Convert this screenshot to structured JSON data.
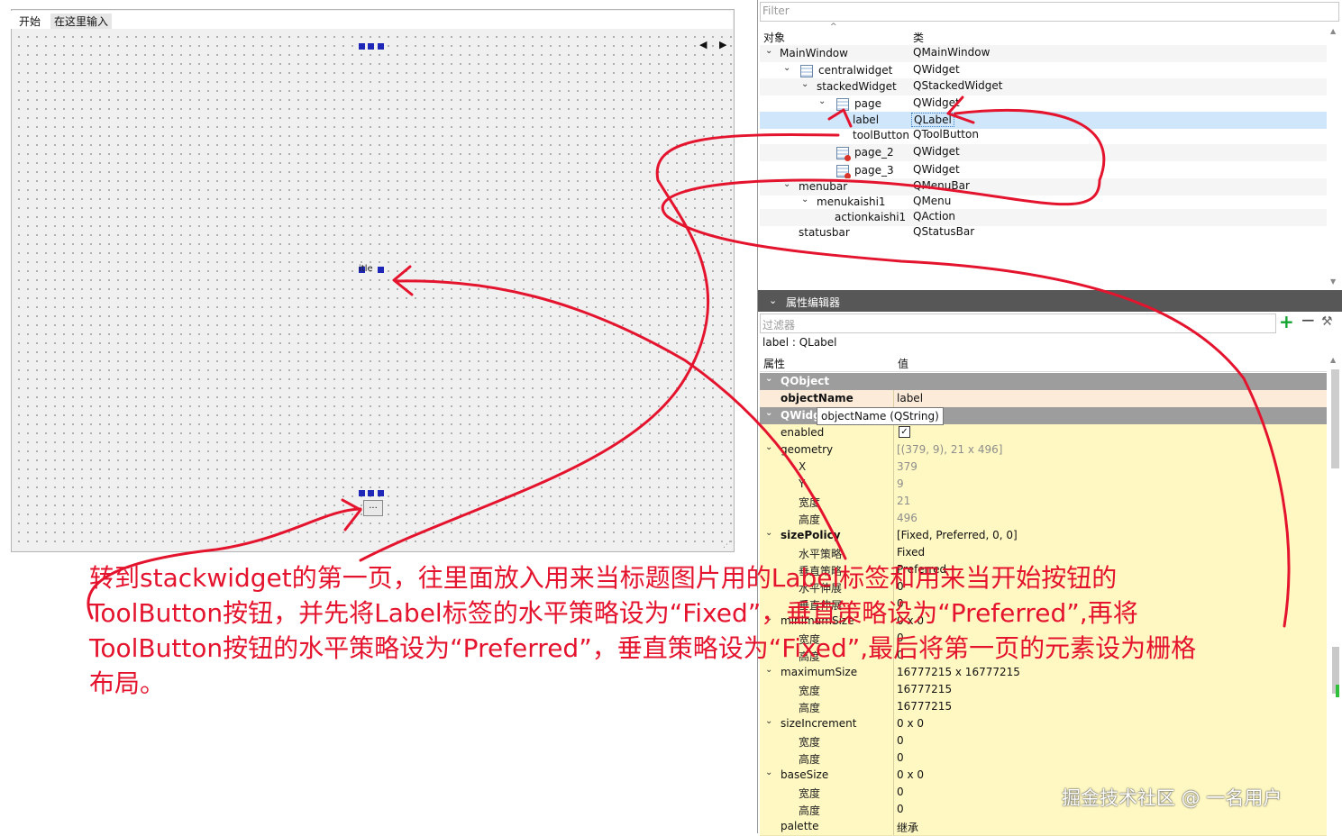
{
  "designer": {
    "menu": {
      "start": "开始",
      "add_placeholder": "在这里输入"
    },
    "label_text": "itle",
    "tool_button_text": "...",
    "nav_arrows": "◀ ▶"
  },
  "object_inspector": {
    "filter_placeholder": "Filter",
    "col_object": "对象",
    "col_class": "类",
    "rows": [
      {
        "name": "MainWindow",
        "class": "QMainWindow"
      },
      {
        "name": "centralwidget",
        "class": "QWidget"
      },
      {
        "name": "stackedWidget",
        "class": "QStackedWidget"
      },
      {
        "name": "page",
        "class": "QWidget"
      },
      {
        "name": "label",
        "class": "QLabel"
      },
      {
        "name": "toolButton",
        "class": "QToolButton"
      },
      {
        "name": "page_2",
        "class": "QWidget"
      },
      {
        "name": "page_3",
        "class": "QWidget"
      },
      {
        "name": "menubar",
        "class": "QMenuBar"
      },
      {
        "name": "menukaishi1",
        "class": "QMenu"
      },
      {
        "name": "actionkaishi1",
        "class": "QAction"
      },
      {
        "name": "statusbar",
        "class": "QStatusBar"
      }
    ]
  },
  "property_editor": {
    "title": "属性编辑器",
    "filter_placeholder": "过滤器",
    "object_info": "label : QLabel",
    "col_property": "属性",
    "col_value": "值",
    "tooltip": "objectName (QString)",
    "rows": [
      {
        "name": "QObject",
        "value": ""
      },
      {
        "name": "objectName",
        "value": "label"
      },
      {
        "name": "QWidget",
        "value": ""
      },
      {
        "name": "enabled",
        "value": "✓"
      },
      {
        "name": "geometry",
        "value": "[(379, 9), 21 x 496]"
      },
      {
        "name": "X",
        "value": "379"
      },
      {
        "name": "Y",
        "value": "9"
      },
      {
        "name": "宽度",
        "value": "21"
      },
      {
        "name": "高度",
        "value": "496"
      },
      {
        "name": "sizePolicy",
        "value": "[Fixed, Preferred, 0, 0]"
      },
      {
        "name": "水平策略",
        "value": "Fixed"
      },
      {
        "name": "垂直策略",
        "value": "Preferred"
      },
      {
        "name": "水平伸展",
        "value": "0"
      },
      {
        "name": "垂直伸展",
        "value": "0"
      },
      {
        "name": "minimumSize",
        "value": "0 x 0"
      },
      {
        "name": "宽度",
        "value": "0"
      },
      {
        "name": "高度",
        "value": "0"
      },
      {
        "name": "maximumSize",
        "value": "16777215 x 16777215"
      },
      {
        "name": "宽度",
        "value": "16777215"
      },
      {
        "name": "高度",
        "value": "16777215"
      },
      {
        "name": "sizeIncrement",
        "value": "0 x 0"
      },
      {
        "name": "宽度",
        "value": "0"
      },
      {
        "name": "高度",
        "value": "0"
      },
      {
        "name": "baseSize",
        "value": "0 x 0"
      },
      {
        "name": "宽度",
        "value": "0"
      },
      {
        "name": "高度",
        "value": "0"
      },
      {
        "name": "palette",
        "value": "继承"
      }
    ]
  },
  "annotation": {
    "line1": "转到stackwidget的第一页，往里面放入用来当标题图片用的Label标签和用来当开始按钮的",
    "line2": "ToolButton按钮，并先将Label标签的水平策略设为“Fixed”，垂直策略设为“Preferred”,再将",
    "line3": "ToolButton按钮的水平策略设为“Preferred”，垂直策略设为“Fixed”,最后将第一页的元素设为栅格",
    "line4": "布局。"
  },
  "watermark": "掘金技术社区 @ 一名用户",
  "colors": {
    "annotation": "#e4142e",
    "group_row": "#9d9d9d",
    "property_row": "#fff8c2",
    "selection": "#cfe6fb",
    "panel_header": "#575757"
  }
}
